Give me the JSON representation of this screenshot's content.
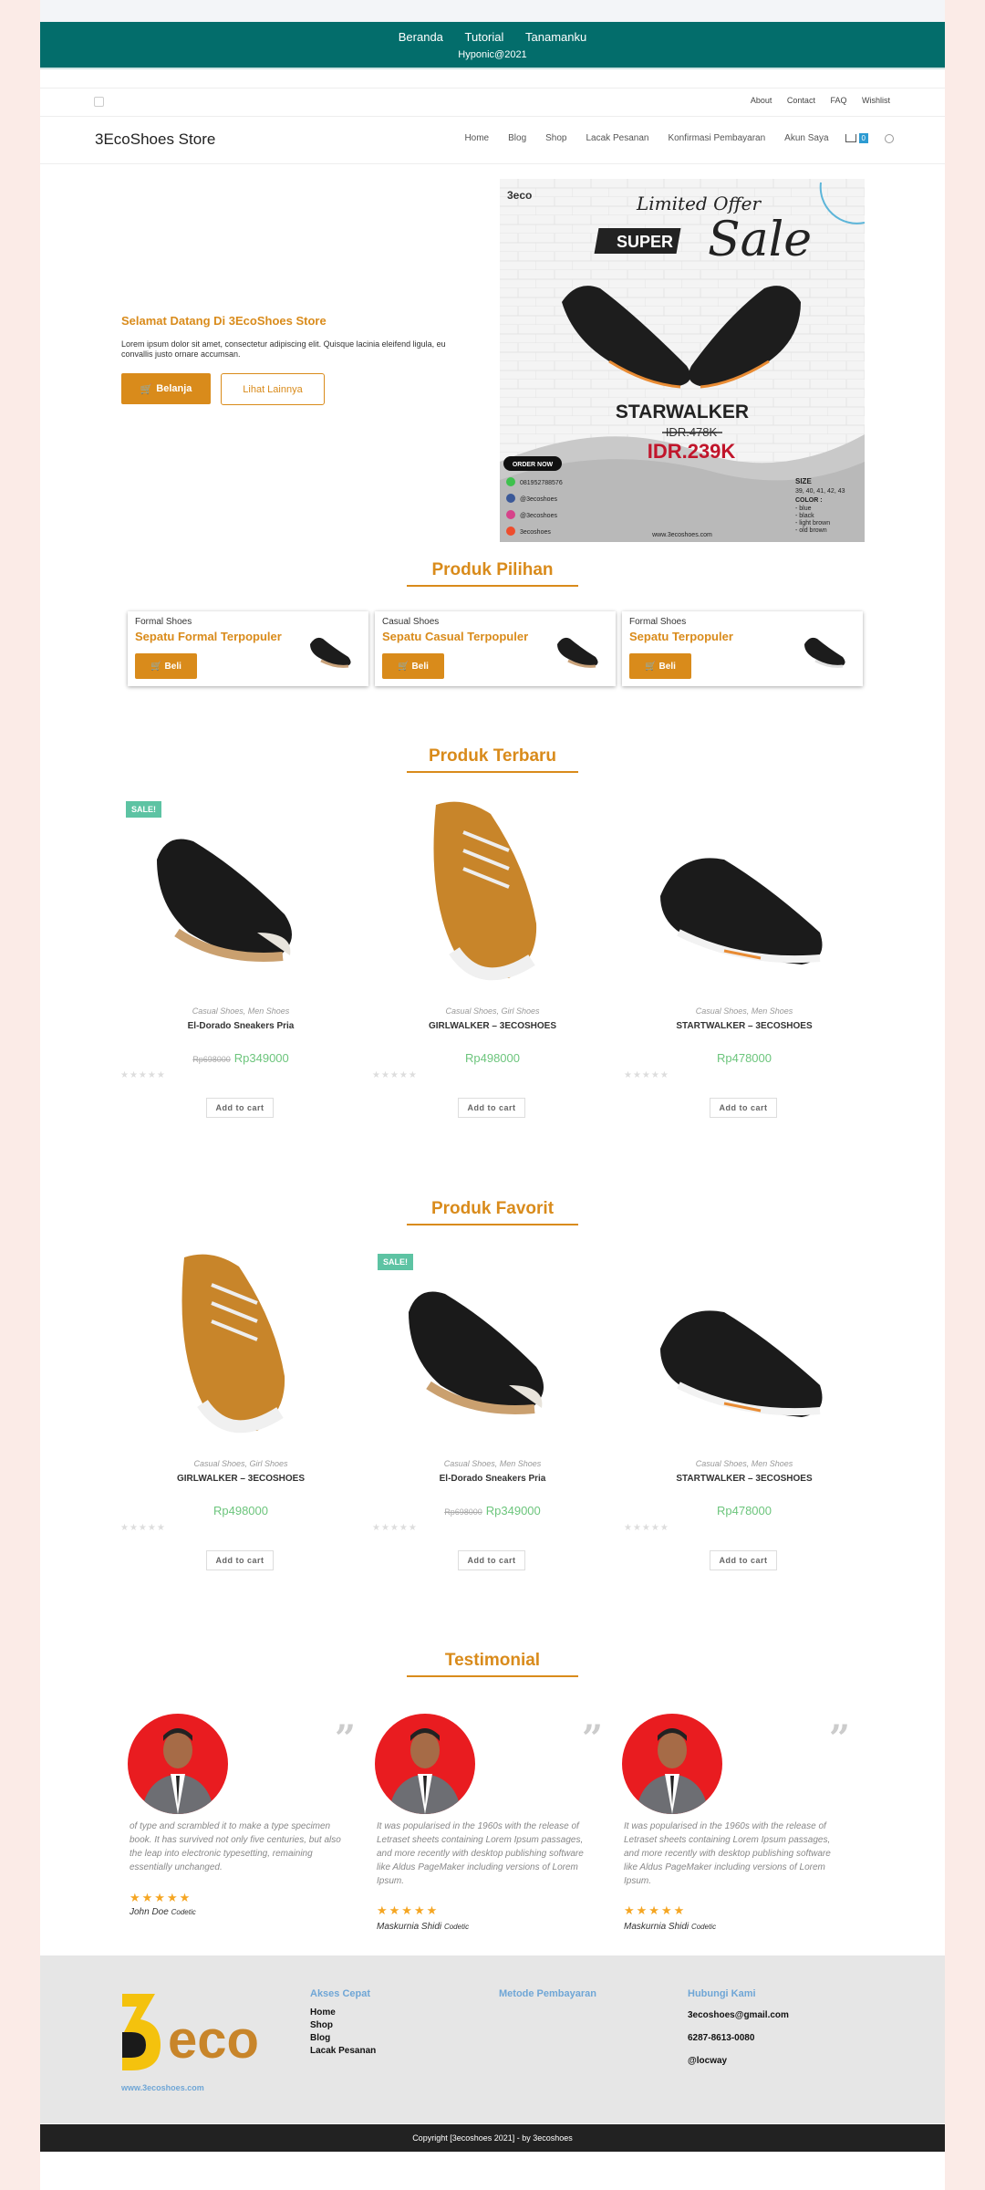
{
  "banner": {
    "nav": [
      "Beranda",
      "Tutorial",
      "Tanamanku"
    ],
    "subtitle": "Hyponic@2021"
  },
  "topbar": {
    "links": [
      "About",
      "Contact",
      "FAQ",
      "Wishlist"
    ]
  },
  "site": {
    "title": "3EcoShoes Store"
  },
  "menu": {
    "items": [
      "Home",
      "Blog",
      "Shop",
      "Lacak Pesanan",
      "Konfirmasi Pembayaran",
      "Akun Saya"
    ],
    "cart_count": "0"
  },
  "hero": {
    "title": "Selamat Datang Di 3EcoShoes Store",
    "text": "Lorem ipsum dolor sit amet, consectetur adipiscing elit. Quisque lacinia eleifend ligula, eu convallis justo ornare accumsan.",
    "btn_primary": "Belanja",
    "btn_secondary": "Lihat Lainnya",
    "promo": {
      "brand": "3eco",
      "limited": "Limited Offer",
      "super": "SUPER",
      "sale": "Sale",
      "product": "STARWALKER",
      "old_price": "IDR.478K",
      "new_price": "IDR.239K",
      "order": "ORDER NOW",
      "whatsapp": "081952788576",
      "facebook": "@3ecoshoes",
      "instagram": "@3ecoshoes",
      "shop": "3ecoshoes",
      "website": "www.3ecoshoes.com",
      "size_label": "SIZE",
      "sizes": "39, 40, 41, 42, 43",
      "color_label": "COLOR :",
      "colors": [
        "- blue",
        "- black",
        "- light brown",
        "- old brown"
      ]
    }
  },
  "sections": {
    "pilihan": "Produk Pilihan",
    "terbaru": "Produk Terbaru",
    "favorit": "Produk Favorit",
    "testimonial": "Testimonial"
  },
  "featured": [
    {
      "category": "Formal Shoes",
      "name": "Sepatu Formal Terpopuler",
      "button": "Beli"
    },
    {
      "category": "Casual Shoes",
      "name": "Sepatu Casual Terpopuler",
      "button": "Beli"
    },
    {
      "category": "Formal Shoes",
      "name": "Sepatu Terpopuler",
      "button": "Beli"
    }
  ],
  "terbaru": [
    {
      "badge": "SALE!",
      "category": "Casual Shoes, Men Shoes",
      "name": "El-Dorado Sneakers Pria",
      "old_price": "Rp698000",
      "price": "Rp349000",
      "button": "Add to cart"
    },
    {
      "badge": "",
      "category": "Casual Shoes, Girl Shoes",
      "name": "GIRLWALKER – 3ECOSHOES",
      "old_price": "",
      "price": "Rp498000",
      "button": "Add to cart"
    },
    {
      "badge": "",
      "category": "Casual Shoes, Men Shoes",
      "name": "STARTWALKER – 3ECOSHOES",
      "old_price": "",
      "price": "Rp478000",
      "button": "Add to cart"
    }
  ],
  "favorit": [
    {
      "badge": "",
      "category": "Casual Shoes, Girl Shoes",
      "name": "GIRLWALKER – 3ECOSHOES",
      "old_price": "",
      "price": "Rp498000",
      "button": "Add to cart"
    },
    {
      "badge": "SALE!",
      "category": "Casual Shoes, Men Shoes",
      "name": "El-Dorado Sneakers Pria",
      "old_price": "Rp698000",
      "price": "Rp349000",
      "button": "Add to cart"
    },
    {
      "badge": "",
      "category": "Casual Shoes, Men Shoes",
      "name": "STARTWALKER – 3ECOSHOES",
      "old_price": "",
      "price": "Rp478000",
      "button": "Add to cart"
    }
  ],
  "testimonials": [
    {
      "text": "of type and scrambled it to make a type specimen book. It has survived not only five centuries, but also the leap into electronic typesetting, remaining essentially unchanged.",
      "name": "John Doe",
      "role": "Codetic",
      "stars": "★★★★★"
    },
    {
      "text": "It was popularised in the 1960s with the release of Letraset sheets containing Lorem Ipsum passages, and more recently with desktop publishing software like Aldus PageMaker including versions of Lorem Ipsum.",
      "name": "Maskurnia Shidi",
      "role": "Codetic",
      "stars": "★★★★★"
    },
    {
      "text": "It was popularised in the 1960s with the release of Letraset sheets containing Lorem Ipsum passages, and more recently with desktop publishing software like Aldus PageMaker including versions of Lorem Ipsum.",
      "name": "Maskurnia Shidi",
      "role": "Codetic",
      "stars": "★★★★★"
    }
  ],
  "footer": {
    "logo_text": "eco",
    "website": "www.3ecoshoes.com",
    "akses_title": "Akses Cepat",
    "akses_links": [
      "Home",
      "Shop",
      "Blog",
      "Lacak Pesanan"
    ],
    "metode_title": "Metode Pembayaran",
    "kontak_title": "Hubungi Kami",
    "email": "3ecoshoes@gmail.com",
    "phone": "6287-8613-0080",
    "handle": "@locway"
  },
  "copyright": "Copyright [3ecoshoes 2021] - by 3ecoshoes",
  "colors": {
    "accent": "#d98b1b",
    "banner": "#036d6b",
    "price": "#6cc57c",
    "sale_badge": "#5dc3a3"
  }
}
